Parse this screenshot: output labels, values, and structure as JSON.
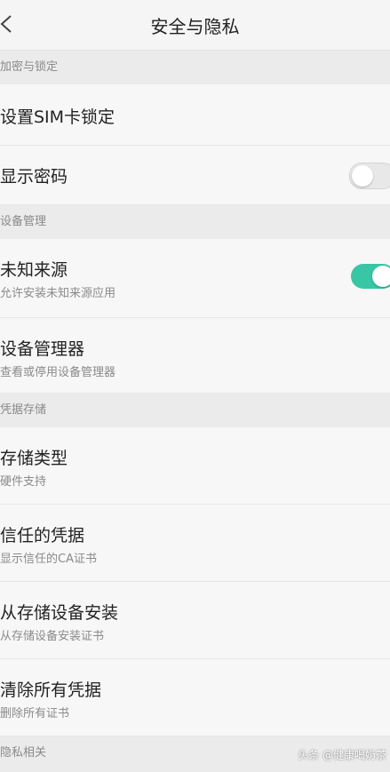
{
  "header": {
    "title": "安全与隐私",
    "back_icon": "chevron-left-icon"
  },
  "sections": {
    "encryption": {
      "label": "加密与锁定",
      "items": [
        {
          "title": "设置SIM卡锁定"
        },
        {
          "title": "显示密码",
          "toggle": false
        }
      ]
    },
    "device": {
      "label": "设备管理",
      "items": [
        {
          "title": "未知来源",
          "subtitle": "允许安装未知来源应用",
          "toggle": true
        },
        {
          "title": "设备管理器",
          "subtitle": "查看或停用设备管理器"
        }
      ]
    },
    "credentials": {
      "label": "凭据存储",
      "items": [
        {
          "title": "存储类型",
          "subtitle": "硬件支持"
        },
        {
          "title": "信任的凭据",
          "subtitle": "显示信任的CA证书"
        },
        {
          "title": "从存储设备安装",
          "subtitle": "从存储设备安装证书"
        },
        {
          "title": "清除所有凭据",
          "subtitle": "删除所有证书"
        }
      ]
    },
    "privacy": {
      "label": "隐私相关"
    }
  },
  "watermark": "头条 @健康喝奶茶",
  "colors": {
    "accent": "#39c6a5",
    "background": "#f2f2f2",
    "section_bg": "#ebebeb"
  }
}
